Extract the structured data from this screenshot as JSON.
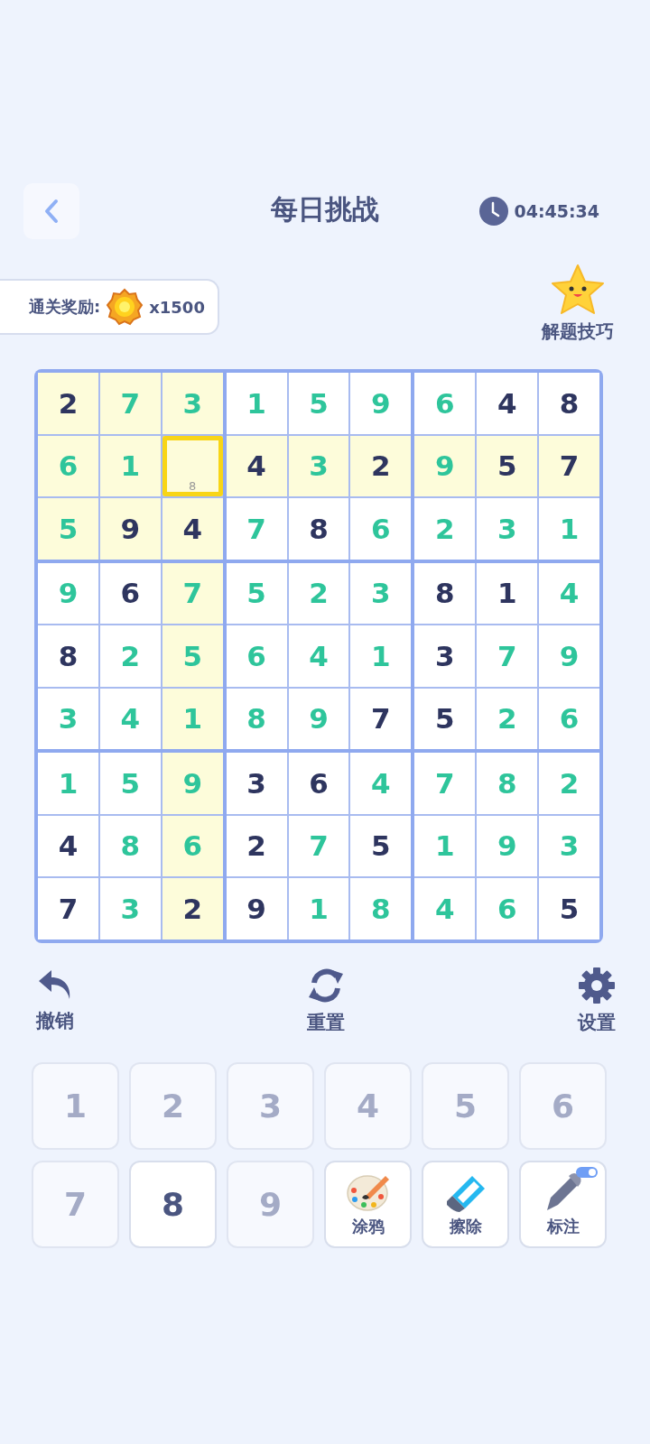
{
  "header": {
    "title": "每日挑战",
    "timer": "04:45:34"
  },
  "reward": {
    "label": "通关奖励:",
    "amount": "x1500"
  },
  "tips": {
    "label": "解题技巧"
  },
  "grid": {
    "rows": [
      [
        {
          "value": "2",
          "given": true,
          "selected": false
        },
        {
          "value": "7",
          "given": false,
          "selected": false
        },
        {
          "value": "3",
          "given": false,
          "selected": false
        },
        {
          "value": "1",
          "given": false,
          "selected": false
        },
        {
          "value": "5",
          "given": false,
          "selected": false
        },
        {
          "value": "9",
          "given": false,
          "selected": false
        },
        {
          "value": "6",
          "given": false,
          "selected": false
        },
        {
          "value": "4",
          "given": true,
          "selected": false
        },
        {
          "value": "8",
          "given": true,
          "selected": false
        }
      ],
      [
        {
          "value": "6",
          "given": false,
          "selected": false
        },
        {
          "value": "1",
          "given": false,
          "selected": false
        },
        {
          "notes": [
            "8"
          ],
          "given": false,
          "selected": true
        },
        {
          "value": "4",
          "given": true,
          "selected": false
        },
        {
          "value": "3",
          "given": false,
          "selected": false
        },
        {
          "value": "2",
          "given": true,
          "selected": false
        },
        {
          "value": "9",
          "given": false,
          "selected": false
        },
        {
          "value": "5",
          "given": true,
          "selected": false
        },
        {
          "value": "7",
          "given": true,
          "selected": false
        }
      ],
      [
        {
          "value": "5",
          "given": false,
          "selected": false
        },
        {
          "value": "9",
          "given": true,
          "selected": false
        },
        {
          "value": "4",
          "given": true,
          "selected": false
        },
        {
          "value": "7",
          "given": false,
          "selected": false
        },
        {
          "value": "8",
          "given": true,
          "selected": false
        },
        {
          "value": "6",
          "given": false,
          "selected": false
        },
        {
          "value": "2",
          "given": false,
          "selected": false
        },
        {
          "value": "3",
          "given": false,
          "selected": false
        },
        {
          "value": "1",
          "given": false,
          "selected": false
        }
      ],
      [
        {
          "value": "9",
          "given": false,
          "selected": false
        },
        {
          "value": "6",
          "given": true,
          "selected": false
        },
        {
          "value": "7",
          "given": false,
          "selected": false
        },
        {
          "value": "5",
          "given": false,
          "selected": false
        },
        {
          "value": "2",
          "given": false,
          "selected": false
        },
        {
          "value": "3",
          "given": false,
          "selected": false
        },
        {
          "value": "8",
          "given": true,
          "selected": false
        },
        {
          "value": "1",
          "given": true,
          "selected": false
        },
        {
          "value": "4",
          "given": false,
          "selected": false
        }
      ],
      [
        {
          "value": "8",
          "given": true,
          "selected": false
        },
        {
          "value": "2",
          "given": false,
          "selected": false
        },
        {
          "value": "5",
          "given": false,
          "selected": false
        },
        {
          "value": "6",
          "given": false,
          "selected": false
        },
        {
          "value": "4",
          "given": false,
          "selected": false
        },
        {
          "value": "1",
          "given": false,
          "selected": false
        },
        {
          "value": "3",
          "given": true,
          "selected": false
        },
        {
          "value": "7",
          "given": false,
          "selected": false
        },
        {
          "value": "9",
          "given": false,
          "selected": false
        }
      ],
      [
        {
          "value": "3",
          "given": false,
          "selected": false
        },
        {
          "value": "4",
          "given": false,
          "selected": false
        },
        {
          "value": "1",
          "given": false,
          "selected": false
        },
        {
          "value": "8",
          "given": false,
          "selected": false
        },
        {
          "value": "9",
          "given": false,
          "selected": false
        },
        {
          "value": "7",
          "given": true,
          "selected": false
        },
        {
          "value": "5",
          "given": true,
          "selected": false
        },
        {
          "value": "2",
          "given": false,
          "selected": false
        },
        {
          "value": "6",
          "given": false,
          "selected": false
        }
      ],
      [
        {
          "value": "1",
          "given": false,
          "selected": false
        },
        {
          "value": "5",
          "given": false,
          "selected": false
        },
        {
          "value": "9",
          "given": false,
          "selected": false
        },
        {
          "value": "3",
          "given": true,
          "selected": false
        },
        {
          "value": "6",
          "given": true,
          "selected": false
        },
        {
          "value": "4",
          "given": false,
          "selected": false
        },
        {
          "value": "7",
          "given": false,
          "selected": false
        },
        {
          "value": "8",
          "given": false,
          "selected": false
        },
        {
          "value": "2",
          "given": false,
          "selected": false
        }
      ],
      [
        {
          "value": "4",
          "given": true,
          "selected": false
        },
        {
          "value": "8",
          "given": false,
          "selected": false
        },
        {
          "value": "6",
          "given": false,
          "selected": false
        },
        {
          "value": "2",
          "given": true,
          "selected": false
        },
        {
          "value": "7",
          "given": false,
          "selected": false
        },
        {
          "value": "5",
          "given": true,
          "selected": false
        },
        {
          "value": "1",
          "given": false,
          "selected": false
        },
        {
          "value": "9",
          "given": false,
          "selected": false
        },
        {
          "value": "3",
          "given": false,
          "selected": false
        }
      ],
      [
        {
          "value": "7",
          "given": true,
          "selected": false
        },
        {
          "value": "3",
          "given": false,
          "selected": false
        },
        {
          "value": "2",
          "given": true,
          "selected": false
        },
        {
          "value": "9",
          "given": true,
          "selected": false
        },
        {
          "value": "1",
          "given": false,
          "selected": false
        },
        {
          "value": "8",
          "given": false,
          "selected": false
        },
        {
          "value": "4",
          "given": false,
          "selected": false
        },
        {
          "value": "6",
          "given": false,
          "selected": false
        },
        {
          "value": "5",
          "given": true,
          "selected": false
        }
      ]
    ]
  },
  "actions": [
    {
      "kind": "undo",
      "label": "撤销"
    },
    {
      "kind": "reset",
      "label": "重置"
    },
    {
      "kind": "settings",
      "label": "设置"
    }
  ],
  "keypad": [
    {
      "label": "1",
      "disabled": true
    },
    {
      "label": "2",
      "disabled": true
    },
    {
      "label": "3",
      "disabled": true
    },
    {
      "label": "4",
      "disabled": true
    },
    {
      "label": "5",
      "disabled": true
    },
    {
      "label": "6",
      "disabled": true
    },
    {
      "label": "7",
      "disabled": true
    },
    {
      "label": "8",
      "disabled": false
    },
    {
      "label": "9",
      "disabled": true
    }
  ],
  "tools": [
    {
      "kind": "doodle",
      "label": "涂鸦"
    },
    {
      "kind": "erase",
      "label": "擦除"
    },
    {
      "kind": "mark",
      "label": "标注",
      "on": true
    }
  ]
}
